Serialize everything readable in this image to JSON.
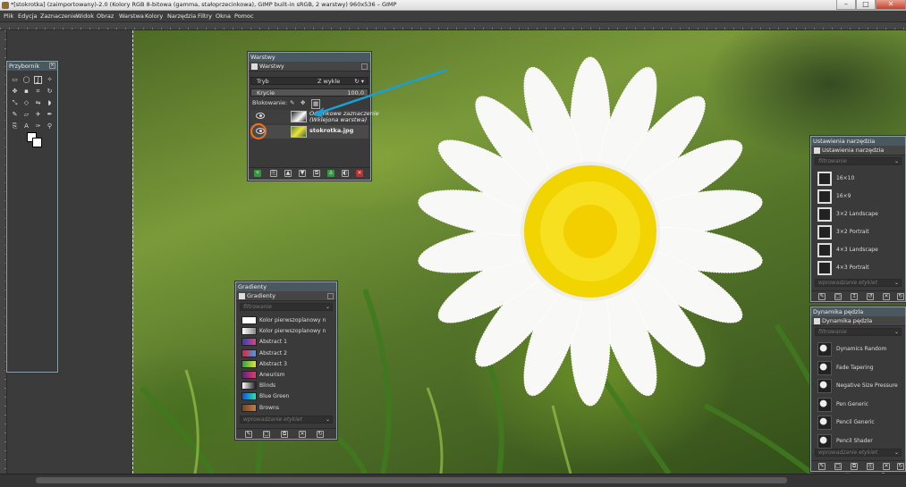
{
  "window": {
    "title": "*[stokrotka] (zaimportowany)-2.0 (Kolory RGB 8-bitowa (gamma, stałoprzecinkowa), GIMP built-in sRGB, 2 warstwy) 960x536 – GIMP",
    "minimize": "–",
    "maximize": "□",
    "close": "✕"
  },
  "menu": [
    "Plik",
    "Edycja",
    "Zaznaczenie",
    "Widok",
    "Obraz",
    "Warstwa",
    "Kolory",
    "Narzędzia",
    "Filtry",
    "Okna",
    "Pomoc"
  ],
  "toolbox": {
    "title": "Przybornik"
  },
  "layers": {
    "dock_title": "Warstwy",
    "tab_label": "Warstwy",
    "mode_label": "Tryb",
    "mode_value": "Z wykle",
    "opacity_label": "Krycie",
    "opacity_value": "100,0",
    "lock_label": "Blokowanie:",
    "items": [
      {
        "name": "Odcinkowe zaznaczenie\n(Wklejona warstwa)"
      },
      {
        "name": "stokrotka.jpg"
      }
    ]
  },
  "gradients": {
    "dock_title": "Gradienty",
    "tab_label": "Gradienty",
    "filter_placeholder": "filtrowanie",
    "tag_placeholder": "wprowadzanie etykiet",
    "items": [
      {
        "name": "Kolor pierwszoplanowy n",
        "colors": [
          "#ffffff",
          "#ffffff"
        ]
      },
      {
        "name": "Kolor pierwszoplanowy n",
        "colors": [
          "#ffffff",
          "#888888"
        ]
      },
      {
        "name": "Abstract 1",
        "colors": [
          "#3040c0",
          "#e04080"
        ]
      },
      {
        "name": "Abstract 2",
        "colors": [
          "#e02040",
          "#40a0e0"
        ]
      },
      {
        "name": "Abstract 3",
        "colors": [
          "#30a040",
          "#e0e040"
        ]
      },
      {
        "name": "Aneurism",
        "colors": [
          "#602080",
          "#e04060"
        ]
      },
      {
        "name": "Blinds",
        "colors": [
          "#ffffff",
          "#202020"
        ]
      },
      {
        "name": "Blue Green",
        "colors": [
          "#1050e0",
          "#30e0a0"
        ]
      },
      {
        "name": "Browns",
        "colors": [
          "#804020",
          "#c08040"
        ]
      }
    ]
  },
  "tool_options": {
    "dock_title": "Ustawienia narzędzia",
    "tab_label": "Ustawienia narzędzia",
    "filter_placeholder": "filtrowanie",
    "tag_placeholder": "wprowadzanie etykiet",
    "items": [
      "16×10",
      "16×9",
      "3×2 Landscape",
      "3×2 Portrait",
      "4×3 Landscape",
      "4×3 Portrait"
    ]
  },
  "brush_dynamics": {
    "dock_title": "Dynamika pędzla",
    "tab_label": "Dynamika pędzla",
    "filter_placeholder": "filtrowanie",
    "tag_placeholder": "wprowadzanie etykiet",
    "items": [
      "Dynamics Random",
      "Fade Tapering",
      "Negative Size Pressure",
      "Pen Generic",
      "Pencil Generic",
      "Pencil Shader"
    ]
  },
  "colors": {
    "annotation_arrow": "#1aa0d8",
    "annotation_circle": "#e87020",
    "dock_head": "#4a5860",
    "button_green": "#2e9a3a",
    "button_red": "#c03030"
  }
}
